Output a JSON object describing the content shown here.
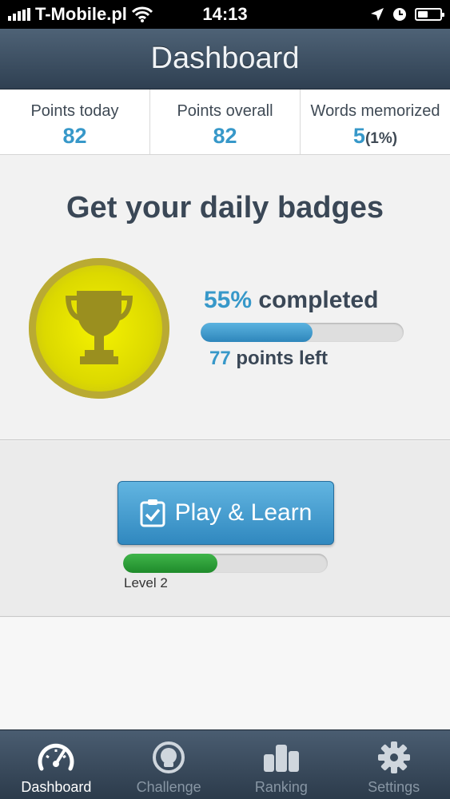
{
  "status_bar": {
    "carrier": "T-Mobile.pl",
    "time": "14:13"
  },
  "header": {
    "title": "Dashboard"
  },
  "stats": {
    "points_today": {
      "label": "Points today",
      "value": "82"
    },
    "points_overall": {
      "label": "Points overall",
      "value": "82"
    },
    "words_memorized": {
      "label": "Words memorized",
      "value": "5",
      "percent": "(1%)"
    }
  },
  "badges": {
    "title": "Get your daily badges",
    "completed_percent": "55%",
    "completed_label": "completed",
    "progress_fraction": 0.55,
    "points_left_value": "77",
    "points_left_label": "points left"
  },
  "play": {
    "button_label": "Play & Learn",
    "level_label": "Level 2",
    "level_progress_fraction": 0.46
  },
  "tabs": [
    {
      "label": "Dashboard",
      "icon": "speedometer-icon",
      "active": true
    },
    {
      "label": "Challenge",
      "icon": "challenge-icon",
      "active": false
    },
    {
      "label": "Ranking",
      "icon": "ranking-icon",
      "active": false
    },
    {
      "label": "Settings",
      "icon": "gear-icon",
      "active": false
    }
  ],
  "colors": {
    "accent": "#3798c9",
    "header": "#3c4e60",
    "level_green": "#2ea23a",
    "trophy_gold": "#dcd900"
  }
}
